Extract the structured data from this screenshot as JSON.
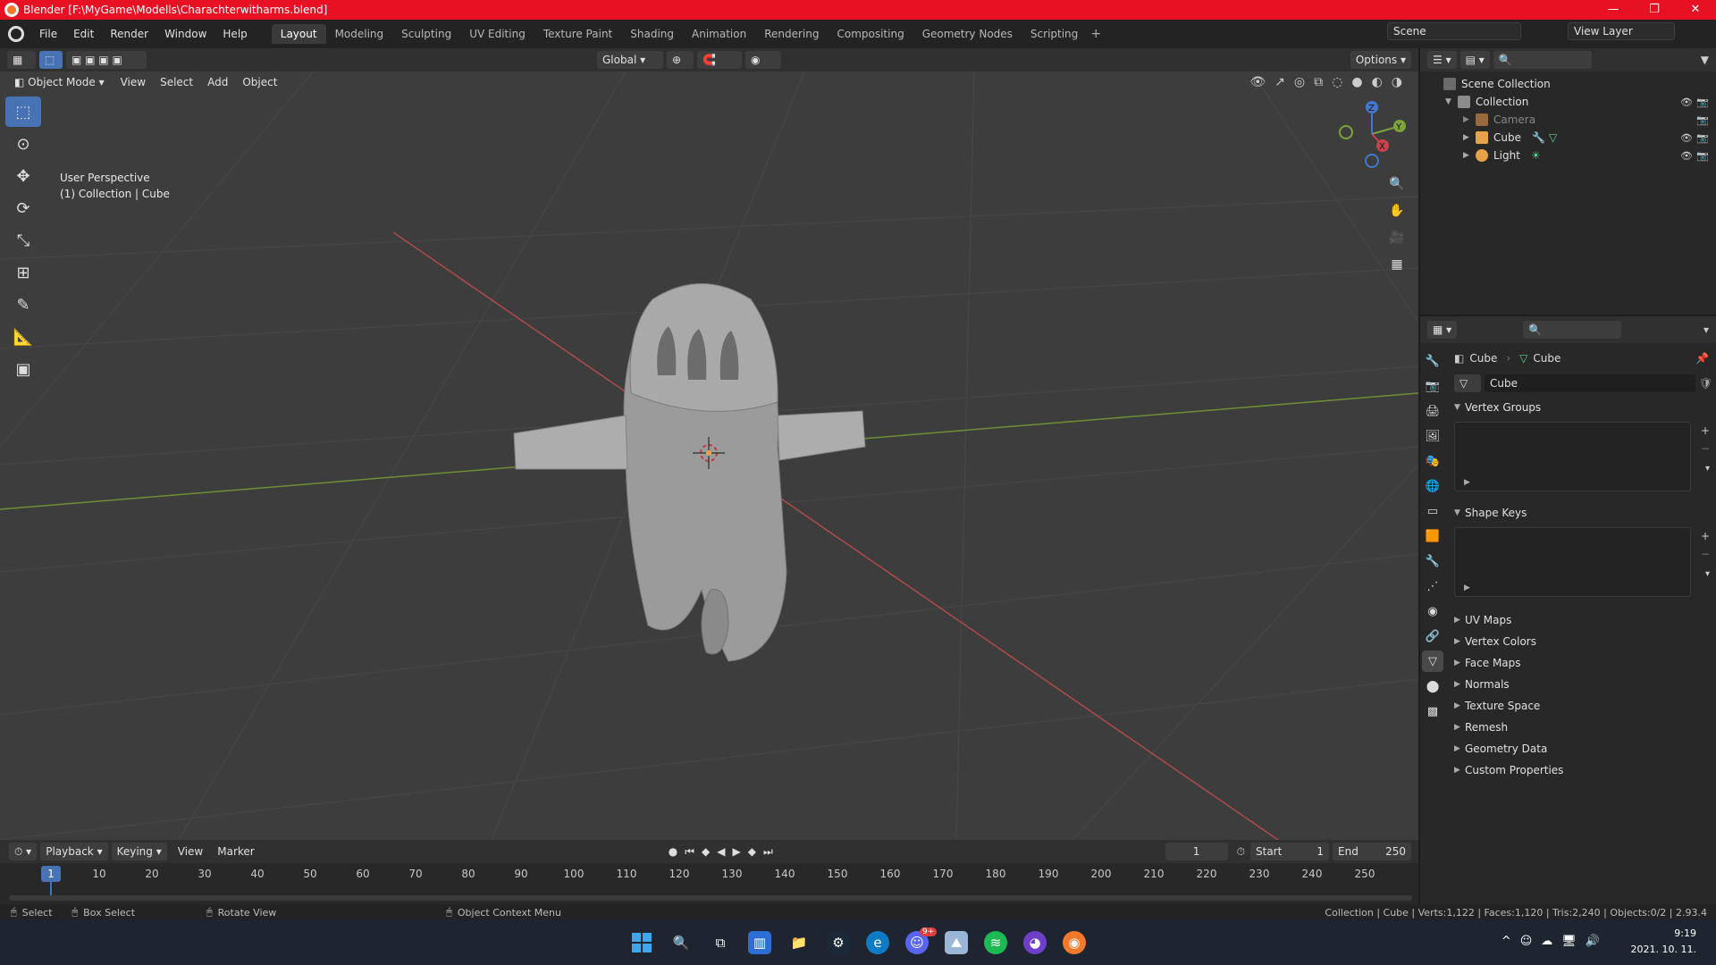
{
  "window": {
    "title": "Blender [F:\\MyGame\\Modells\\Charachterwitharms.blend]",
    "minimize": "—",
    "maximize": "❐",
    "close": "✕"
  },
  "menu": [
    "File",
    "Edit",
    "Render",
    "Window",
    "Help"
  ],
  "workspaces": [
    "Layout",
    "Modeling",
    "Sculpting",
    "UV Editing",
    "Texture Paint",
    "Shading",
    "Animation",
    "Rendering",
    "Compositing",
    "Geometry Nodes",
    "Scripting"
  ],
  "active_workspace": "Layout",
  "scene": "Scene",
  "view_layer": "View Layer",
  "viewport": {
    "mode": "Object Mode",
    "menus": [
      "View",
      "Select",
      "Add",
      "Object"
    ],
    "orientation": "Global",
    "options": "Options",
    "perspective": "User Perspective",
    "collection_info": "(1) Collection | Cube",
    "gizmo": {
      "x": "X",
      "y": "Y",
      "z": "Z"
    }
  },
  "outliner": {
    "scene_collection": "Scene Collection",
    "collection": "Collection",
    "items": [
      {
        "name": "Camera",
        "color": "#d18a3c"
      },
      {
        "name": "Cube",
        "color": "#e8a34a"
      },
      {
        "name": "Light",
        "color": "#e8a34a"
      }
    ]
  },
  "properties": {
    "object": "Cube",
    "mesh": "Cube",
    "data_name": "Cube",
    "sections_open": [
      "Vertex Groups",
      "Shape Keys"
    ],
    "sections_closed": [
      "UV Maps",
      "Vertex Colors",
      "Face Maps",
      "Normals",
      "Texture Space",
      "Remesh",
      "Geometry Data",
      "Custom Properties"
    ]
  },
  "timeline": {
    "menus": [
      "Playback",
      "Keying",
      "View",
      "Marker"
    ],
    "current_frame": "1",
    "start_label": "Start",
    "start": "1",
    "end_label": "End",
    "end": "250",
    "ticks": [
      "10",
      "20",
      "30",
      "40",
      "50",
      "60",
      "70",
      "80",
      "90",
      "100",
      "110",
      "120",
      "130",
      "140",
      "150",
      "160",
      "170",
      "180",
      "190",
      "200",
      "210",
      "220",
      "230",
      "240",
      "250"
    ]
  },
  "status": {
    "select": "Select",
    "box_select": "Box Select",
    "rotate_view": "Rotate View",
    "context_menu": "Object Context Menu",
    "stats": "Collection | Cube | Verts:1,122 | Faces:1,120 | Tris:2,240 | Objects:0/2 | 2.93.4"
  },
  "taskbar": {
    "time": "9:19",
    "date": "2021. 10. 11.",
    "badge": "9+"
  },
  "colors": {
    "accent": "#4772b3",
    "title_red": "#e81123",
    "x_axis": "#c8434b",
    "y_axis": "#7ca339",
    "z_axis": "#4477cc"
  }
}
